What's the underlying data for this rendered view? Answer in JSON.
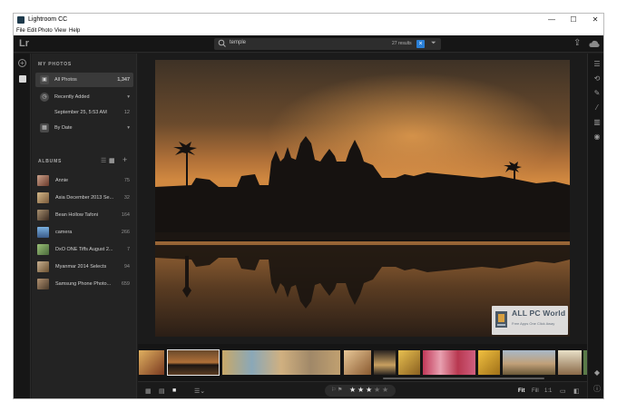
{
  "window": {
    "title": "Lightroom CC",
    "min": "—",
    "max": "☐",
    "close": "✕"
  },
  "menu": [
    "File",
    "Edit",
    "Photo",
    "View",
    "Help"
  ],
  "toolbar": {
    "logo": "Lr",
    "search_value": "temple",
    "result_count": "27 results",
    "clear_icon": "close-icon",
    "filter_icon": "filter-icon",
    "share_icon": "share-icon",
    "cloud_icon": "cloud-icon"
  },
  "left_strip": {
    "add_icon": "plus-icon",
    "library_icon": "library-icon"
  },
  "my_photos": {
    "heading": "MY PHOTOS",
    "items": [
      {
        "label": "All Photos",
        "count": "1,347",
        "icon": "photos-icon"
      },
      {
        "label": "Recently Added",
        "count": "▾",
        "icon": "clock-icon"
      },
      {
        "label": "September 25, 5:53 AM",
        "count": "12",
        "icon": ""
      },
      {
        "label": "By Date",
        "count": "▾",
        "icon": "calendar-icon"
      }
    ]
  },
  "albums": {
    "heading": "ALBUMS",
    "items": [
      {
        "label": "Annie",
        "count": "75",
        "color": "#8a5a4a"
      },
      {
        "label": "Asia December 2013 Se...",
        "count": "32",
        "color": "#9a7c5a"
      },
      {
        "label": "Bean Hollow Tafoni",
        "count": "164",
        "color": "#6a5a48"
      },
      {
        "label": "camera",
        "count": "266",
        "color": "#4a76a8"
      },
      {
        "label": "DxO ONE Tiffs August 2...",
        "count": "7",
        "color": "#6c8c5a"
      },
      {
        "label": "Myanmar 2014 Selects",
        "count": "94",
        "color": "#a08a6a"
      },
      {
        "label": "Samsung Phone Photo...",
        "count": "659",
        "color": "#7a6a58"
      }
    ]
  },
  "watermark": {
    "title": "ALL PC World",
    "subtitle": "Free Apps One Click Away"
  },
  "filmstrip": {
    "thumbs": [
      {
        "color": "#c48a3a",
        "selected": false
      },
      {
        "color": "#7a4a22",
        "selected": true
      },
      {
        "color": "#b8a070",
        "selected": false
      },
      {
        "color": "#a68a58",
        "selected": false
      },
      {
        "color": "#d0b890",
        "selected": false
      },
      {
        "color": "#3a3028",
        "selected": false
      },
      {
        "color": "#c8a040",
        "selected": false
      },
      {
        "color": "#b83850",
        "selected": false
      },
      {
        "color": "#d4a830",
        "selected": false
      },
      {
        "color": "#9a7a5a",
        "selected": false
      },
      {
        "color": "#8aa0b8",
        "selected": false
      },
      {
        "color": "#5a7a48",
        "selected": false
      }
    ]
  },
  "bottombar": {
    "zoom_fit": "Fit",
    "zoom_fill": "Fill",
    "zoom_1to1": "1:1",
    "rating": 3,
    "rating_max": 5
  }
}
